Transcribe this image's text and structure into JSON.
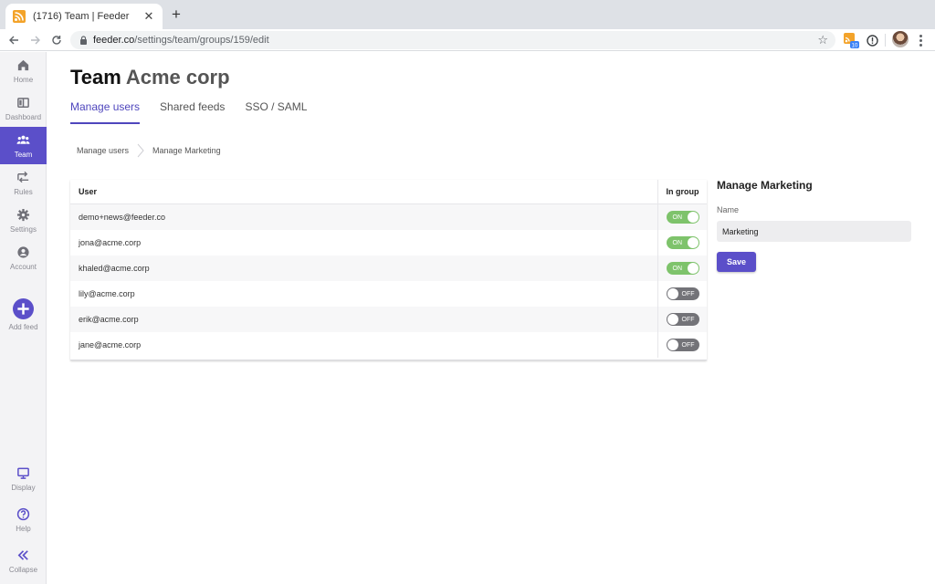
{
  "browser": {
    "tab_title": "(1716) Team | Feeder",
    "url_host": "feeder.co",
    "url_path": "/settings/team/groups/159/edit",
    "extension_badge": "10",
    "accent_color": "#5b4fc9"
  },
  "sidebar": {
    "items": [
      {
        "label": "Home",
        "icon": "home-icon"
      },
      {
        "label": "Dashboard",
        "icon": "dashboard-icon"
      },
      {
        "label": "Team",
        "icon": "team-icon",
        "active": true
      },
      {
        "label": "Rules",
        "icon": "rules-icon"
      },
      {
        "label": "Settings",
        "icon": "gear-icon"
      },
      {
        "label": "Account",
        "icon": "account-icon"
      },
      {
        "label": "Add feed",
        "icon": "plus-icon"
      }
    ],
    "bottom_items": [
      {
        "label": "Display",
        "icon": "monitor-icon"
      },
      {
        "label": "Help",
        "icon": "help-icon"
      },
      {
        "label": "Collapse",
        "icon": "double-chevron-left-icon"
      }
    ]
  },
  "page": {
    "title_strong": "Team",
    "title_light": "Acme corp",
    "tabs": [
      {
        "label": "Manage users",
        "active": true
      },
      {
        "label": "Shared feeds"
      },
      {
        "label": "SSO / SAML"
      }
    ],
    "breadcrumb": [
      "Manage users",
      "Manage Marketing"
    ]
  },
  "table": {
    "headers": {
      "user": "User",
      "in_group": "In group"
    },
    "rows": [
      {
        "email": "demo+news@feeder.co",
        "state": "ON"
      },
      {
        "email": "jona@acme.corp",
        "state": "ON"
      },
      {
        "email": "khaled@acme.corp",
        "state": "ON"
      },
      {
        "email": "lily@acme.corp",
        "state": "OFF"
      },
      {
        "email": "erik@acme.corp",
        "state": "OFF"
      },
      {
        "email": "jane@acme.corp",
        "state": "OFF"
      }
    ]
  },
  "panel": {
    "title": "Manage Marketing",
    "name_label": "Name",
    "name_value": "Marketing",
    "save_label": "Save"
  }
}
